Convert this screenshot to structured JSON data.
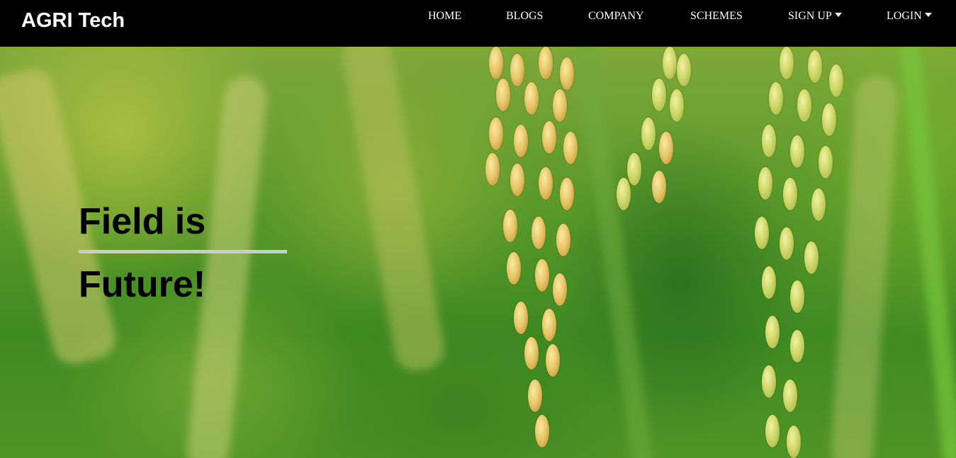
{
  "brand": {
    "name": "AGRI Tech"
  },
  "nav": {
    "items": [
      {
        "label": "HOME",
        "dropdown": false
      },
      {
        "label": "BLOGS",
        "dropdown": false
      },
      {
        "label": "COMPANY",
        "dropdown": false
      },
      {
        "label": "SCHEMES",
        "dropdown": false
      },
      {
        "label": "SIGN UP",
        "dropdown": true
      },
      {
        "label": "LOGIN",
        "dropdown": true
      }
    ]
  },
  "hero": {
    "background": "rice-field-photo",
    "headline_line1": "Field is",
    "headline_line2": "Future!"
  },
  "colors": {
    "navbar_bg": "#000000",
    "nav_text": "#ffffff",
    "headline_text": "#000000",
    "divider": "#c8cbd0"
  }
}
